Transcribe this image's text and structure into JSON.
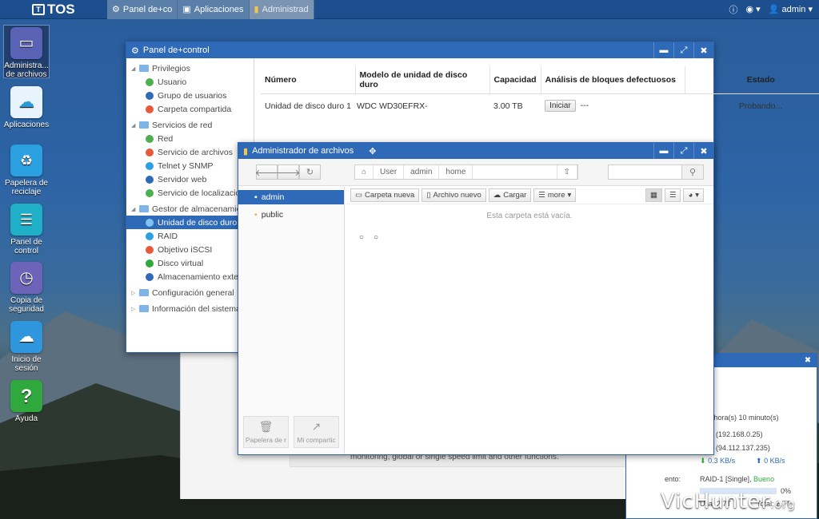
{
  "topbar": {
    "logo": "TOS",
    "tabs": [
      {
        "label": "Panel de+co"
      },
      {
        "label": "Aplicaciones"
      },
      {
        "label": "Administrad"
      }
    ],
    "user": "admin"
  },
  "desktop": {
    "icons": [
      {
        "label": "Administra... de archivos",
        "color": "#5a62b5"
      },
      {
        "label": "Aplicaciones",
        "color": "#e8f4fb"
      },
      {
        "label": "Papelera de reciclaje",
        "color": "#2aa0e0"
      },
      {
        "label": "Panel de control",
        "color": "#1fb0c8"
      },
      {
        "label": "Copia de seguridad",
        "color": "#6d63b8"
      },
      {
        "label": "Inicio de sesión",
        "color": "#2e96dc"
      },
      {
        "label": "Ayuda",
        "color": "#2fa83d"
      }
    ]
  },
  "control_panel": {
    "title": "Panel de+control",
    "tree": [
      {
        "type": "group",
        "label": "Privilegios"
      },
      {
        "type": "child",
        "label": "Usuario",
        "color": "#4caf50"
      },
      {
        "type": "child",
        "label": "Grupo de usuarios",
        "color": "#2f6ab8"
      },
      {
        "type": "child",
        "label": "Carpeta compartida",
        "color": "#e65a3b"
      },
      {
        "type": "group",
        "label": "Servicios de red"
      },
      {
        "type": "child",
        "label": "Red",
        "color": "#4caf50"
      },
      {
        "type": "child",
        "label": "Servicio de archivos",
        "color": "#e65a3b"
      },
      {
        "type": "child",
        "label": "Telnet y SNMP",
        "color": "#2aa0e0"
      },
      {
        "type": "child",
        "label": "Servidor web",
        "color": "#2f6ab8"
      },
      {
        "type": "child",
        "label": "Servicio de localización",
        "color": "#4caf50"
      },
      {
        "type": "group",
        "label": "Gestor de almacenamiento"
      },
      {
        "type": "child",
        "label": "Unidad de disco duro",
        "color": "#7fc3ef",
        "active": true
      },
      {
        "type": "child",
        "label": "RAID",
        "color": "#2aa0e0"
      },
      {
        "type": "child",
        "label": "Objetivo iSCSI",
        "color": "#e65a3b"
      },
      {
        "type": "child",
        "label": "Disco virtual",
        "color": "#2fa83d"
      },
      {
        "type": "child",
        "label": "Almacenamiento externo",
        "color": "#2f6ab8"
      },
      {
        "type": "group",
        "label": "Configuración general"
      },
      {
        "type": "group",
        "label": "Información del sistema"
      }
    ],
    "table": {
      "headers": [
        "Número",
        "Modelo de unidad de disco duro",
        "Capacidad",
        "Análisis de bloques defectuosos",
        "Estado"
      ],
      "row": {
        "numero": "Unidad de disco duro 1",
        "modelo": "WDC WD30EFRX-",
        "capacidad": "3.00 TB",
        "boton": "Iniciar",
        "analisis": "---",
        "estado": "Probando..."
      }
    }
  },
  "file_manager": {
    "title": "Administrador de archivos",
    "breadcrumb": [
      "User",
      "admin",
      "home"
    ],
    "sidebar": [
      {
        "label": "admin",
        "active": true
      },
      {
        "label": "public"
      }
    ],
    "actions": {
      "new_folder": "Carpeta nueva",
      "new_file": "Archivo nuevo",
      "upload": "Cargar",
      "more": "more"
    },
    "empty_message": "Esta carpeta está vacía.",
    "bottom": {
      "trash": "Papelera de r",
      "shared": "Mi compartic"
    }
  },
  "back_window": {
    "text": "monitoring, global or single speed limit and other functions."
  },
  "status_window": {
    "title": "na",
    "lines": {
      "worker": "rker",
      "uptime": "s) 0 hora(s) 10 minuto(s)",
      "lan": "tado (192.168.0.25)",
      "wan": "tado (94.112.137.235)",
      "down": "0.3 KB/s",
      "up": "0 KB/s",
      "raid_label": "ento:",
      "raid_value": "RAID-1 [Single],",
      "raid_state": "Bueno",
      "percent": "0%",
      "usage": "Usa: 2.7T",
      "total": "Total: 2.7T"
    }
  },
  "watermark": {
    "main": "VicHunter",
    "suffix": ".org"
  }
}
